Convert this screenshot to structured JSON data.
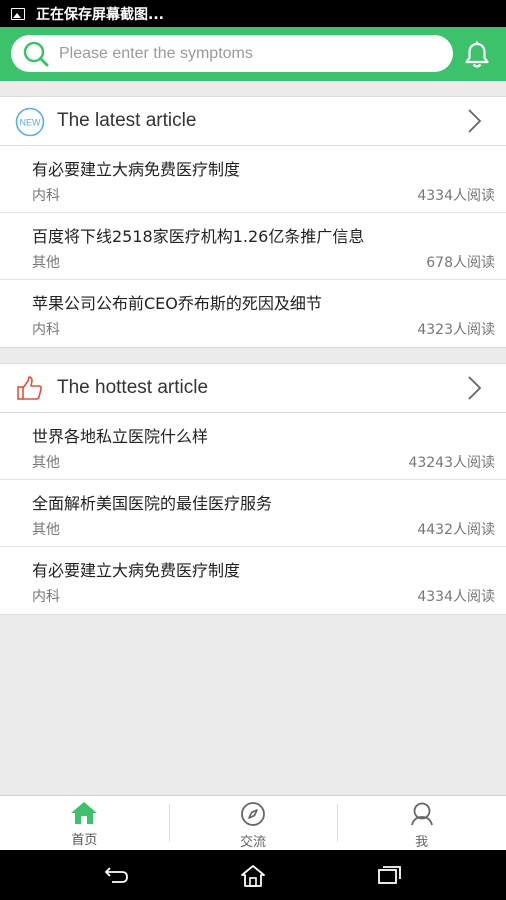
{
  "status_bar": {
    "text": "正在保存屏幕截图...",
    "icon": "image-icon"
  },
  "search": {
    "placeholder": "Please enter the symptoms",
    "icon": "search-icon"
  },
  "header": {
    "color": "#3cc26a",
    "bell_icon": "bell-icon"
  },
  "latest": {
    "title": "The latest article",
    "icon": "new-badge-icon",
    "articles": [
      {
        "title": "有必要建立大病免费医疗制度",
        "category": "内科",
        "reads": "4334人阅读"
      },
      {
        "title": "百度将下线2518家医疗机构1.26亿条推广信息",
        "category": "其他",
        "reads": "678人阅读"
      },
      {
        "title": "苹果公司公布前CEO乔布斯的死因及细节",
        "category": "内科",
        "reads": "4323人阅读"
      }
    ]
  },
  "hottest": {
    "title": "The hottest article",
    "icon": "thumbs-up-icon",
    "articles": [
      {
        "title": "世界各地私立医院什么样",
        "category": "其他",
        "reads": "43243人阅读"
      },
      {
        "title": "全面解析美国医院的最佳医疗服务",
        "category": "其他",
        "reads": "4432人阅读"
      },
      {
        "title": "有必要建立大病免费医疗制度",
        "category": "内科",
        "reads": "4334人阅读"
      }
    ]
  },
  "tabs": [
    {
      "label": "首页",
      "icon": "home-icon",
      "active": true
    },
    {
      "label": "交流",
      "icon": "compass-icon",
      "active": false
    },
    {
      "label": "我",
      "icon": "user-icon",
      "active": false
    }
  ],
  "nav": {
    "back": "back-icon",
    "home": "home-nav-icon",
    "recents": "recents-icon"
  }
}
